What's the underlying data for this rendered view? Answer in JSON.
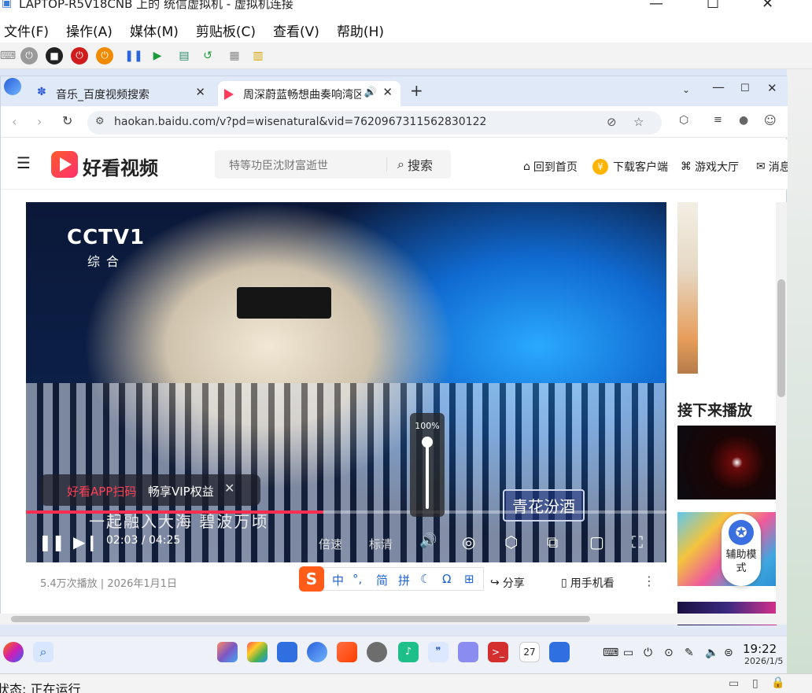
{
  "host": {
    "title": "LAPTOP-R5V18CNB 上的 统信虚拟机 - 虚拟机连接",
    "menu": [
      "文件(F)",
      "操作(A)",
      "媒体(M)",
      "剪贴板(C)",
      "查看(V)",
      "帮助(H)"
    ],
    "status": "状态: 正在运行"
  },
  "browser": {
    "tabs": [
      {
        "label": "音乐_百度视频搜索"
      },
      {
        "label": "周深蔚蓝畅想曲奏响湾区"
      }
    ],
    "new_tab": "+",
    "url": "haokan.baidu.com/v?pd=wisenatural&vid=7620967311562830122"
  },
  "site": {
    "logo": "好看视频",
    "search_placeholder": "特等功臣沈财富逝世",
    "search_button": "搜索",
    "nav": [
      "回到首页",
      "下载客户端",
      "游戏大厅",
      "消息"
    ]
  },
  "player": {
    "channel": "CCTV1",
    "channel_sub": "综合",
    "subtitle": "一起融入大海 碧波万顷",
    "sponsor": "青花汾酒",
    "promo_red": "好看APP扫码",
    "promo_white": "畅享VIP权益",
    "time_current": "02:03",
    "time_sep": "/",
    "time_total": "04:25",
    "progress": 0.464,
    "volume_label": "100%",
    "speed_label": "倍速",
    "quality_label": "标清"
  },
  "meta": {
    "views_date": "5.4万次播放 | 2026年1月1日",
    "share": "分享",
    "phone_watch": "用手机看",
    "more": "⋮"
  },
  "ime": {
    "logo": "S",
    "items": [
      "中",
      "°,",
      "简",
      "拼",
      "☾",
      "Ω",
      "⊞"
    ]
  },
  "sidebar": {
    "up_next": "接下来播放",
    "assist_label": "辅助模式"
  },
  "taskbar": {
    "time": "19:22",
    "date": "2026/1/5",
    "calendar_day": "27"
  }
}
